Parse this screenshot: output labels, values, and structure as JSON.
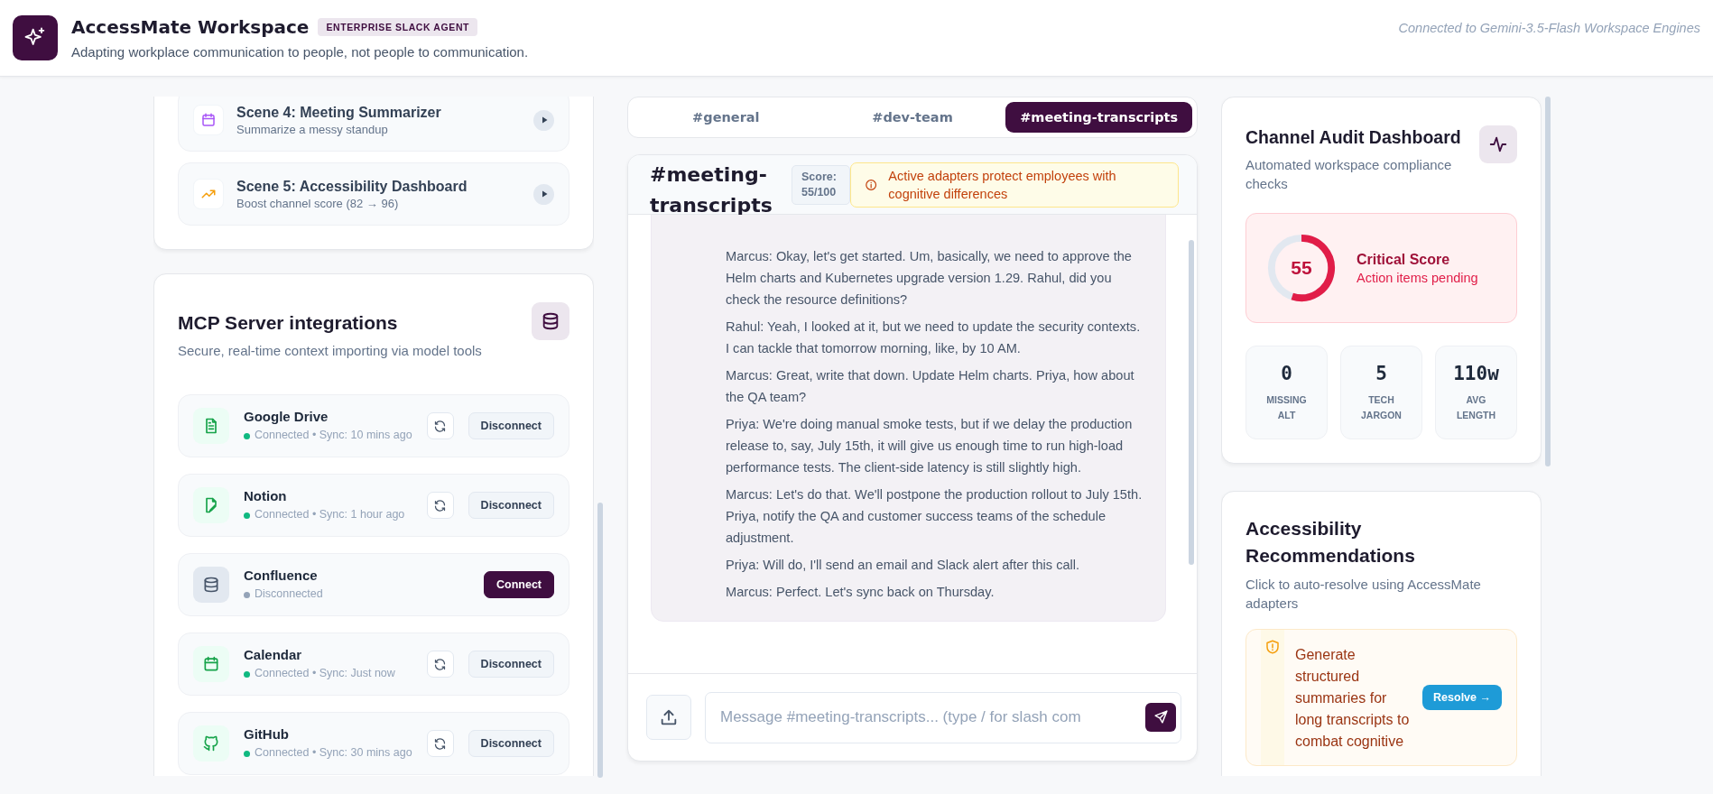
{
  "header": {
    "title": "AccessMate Workspace",
    "badge": "ENTERPRISE SLACK AGENT",
    "tagline": "Adapting workplace communication to people, not people to communication.",
    "connection": "Connected to Gemini-3.5-Flash Workspace Engines"
  },
  "scenes": [
    {
      "kind": "calendar",
      "title": "Scene 4: Meeting Summarizer",
      "subtitle": "Summarize a messy standup"
    },
    {
      "kind": "trend",
      "title": "Scene 5: Accessibility Dashboard",
      "subtitle": "Boost channel score (82 → 96)"
    }
  ],
  "mcp": {
    "title": "MCP Server integrations",
    "subtitle": "Secure, real-time context importing via model tools",
    "servers": [
      {
        "kind": "doc",
        "name": "Google Drive",
        "connected": true,
        "status": "Connected • Sync: 10 mins ago",
        "action": "Disconnect"
      },
      {
        "kind": "file-edit",
        "name": "Notion",
        "connected": true,
        "status": "Connected • Sync: 1 hour ago",
        "action": "Disconnect"
      },
      {
        "kind": "database",
        "name": "Confluence",
        "connected": false,
        "status": "Disconnected",
        "action": "Connect"
      },
      {
        "kind": "calendar",
        "name": "Calendar",
        "connected": true,
        "status": "Connected • Sync: Just now",
        "action": "Disconnect"
      },
      {
        "kind": "github",
        "name": "GitHub",
        "connected": true,
        "status": "Connected • Sync: 30 mins ago",
        "action": "Disconnect"
      }
    ]
  },
  "tabs": [
    {
      "label": "#general",
      "selected": false
    },
    {
      "label": "#dev-team",
      "selected": false
    },
    {
      "label": "#meeting-transcripts",
      "selected": true
    }
  ],
  "chat": {
    "title": "#meeting-transcripts",
    "score": "Score: 55/100",
    "notice": "Active adapters protect employees with cognitive differences",
    "messages": [
      "Marcus: Okay, let's get started. Um, basically, we need to approve the Helm charts and Kubernetes upgrade version 1.29. Rahul, did you check the resource definitions?",
      "Rahul: Yeah, I looked at it, but we need to update the security contexts. I can tackle that tomorrow morning, like, by 10 AM.",
      "Marcus: Great, write that down. Update Helm charts. Priya, how about the QA team?",
      "Priya: We're doing manual smoke tests, but if we delay the production release to, say, July 15th, it will give us enough time to run high-load performance tests. The client-side latency is still slightly high.",
      "Marcus: Let's do that. We'll postpone the production rollout to July 15th. Priya, notify the QA and customer success teams of the schedule adjustment.",
      "Priya: Will do, I'll send an email and Slack alert after this call.",
      "Marcus: Perfect. Let's sync back on Thursday."
    ],
    "placeholder": "Message #meeting-transcripts... (type / for slash com"
  },
  "audit": {
    "title": "Channel Audit Dashboard",
    "subtitle": "Automated workspace compliance checks",
    "score": {
      "value": "55",
      "level": 0.55,
      "label": "Critical Score",
      "sublabel": "Action items pending"
    },
    "stats": [
      {
        "value": "0",
        "label": "MISSING ALT"
      },
      {
        "value": "5",
        "label": "TECH JARGON"
      },
      {
        "value": "110w",
        "label": "AVG LENGTH"
      }
    ]
  },
  "recommendations": {
    "title": "Accessibility Recommendations",
    "subtitle": "Click to auto-resolve using AccessMate adapters",
    "items": [
      {
        "text": "Generate structured summaries for long transcripts to combat cognitive",
        "action": "Resolve →"
      }
    ]
  }
}
